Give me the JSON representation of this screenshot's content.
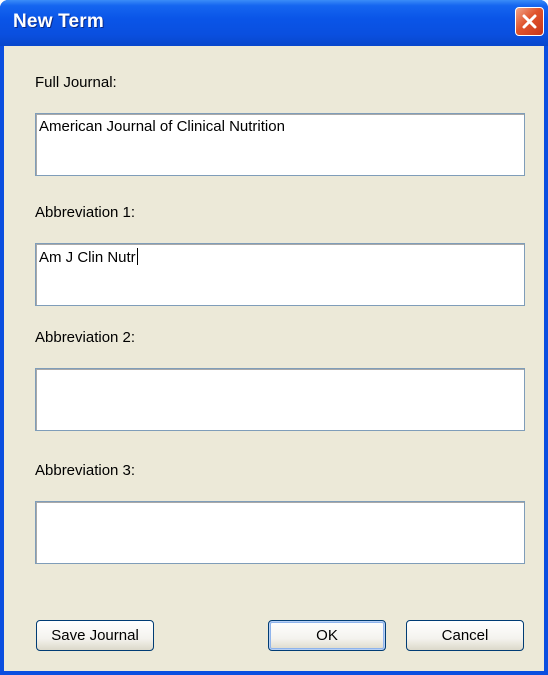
{
  "window": {
    "title": "New Term",
    "close_icon": "close-x-icon"
  },
  "form": {
    "full_journal": {
      "label": "Full Journal:",
      "value": "American Journal of Clinical Nutrition"
    },
    "abbreviation_1": {
      "label": "Abbreviation 1:",
      "value": "Am J Clin Nutr"
    },
    "abbreviation_2": {
      "label": "Abbreviation 2:",
      "value": ""
    },
    "abbreviation_3": {
      "label": "Abbreviation 3:",
      "value": ""
    }
  },
  "buttons": {
    "save_journal": "Save Journal",
    "ok": "OK",
    "cancel": "Cancel"
  },
  "colors": {
    "titlebar": "#0a55e8",
    "dialog_face": "#ece9d8",
    "close_button": "#e0542c"
  }
}
